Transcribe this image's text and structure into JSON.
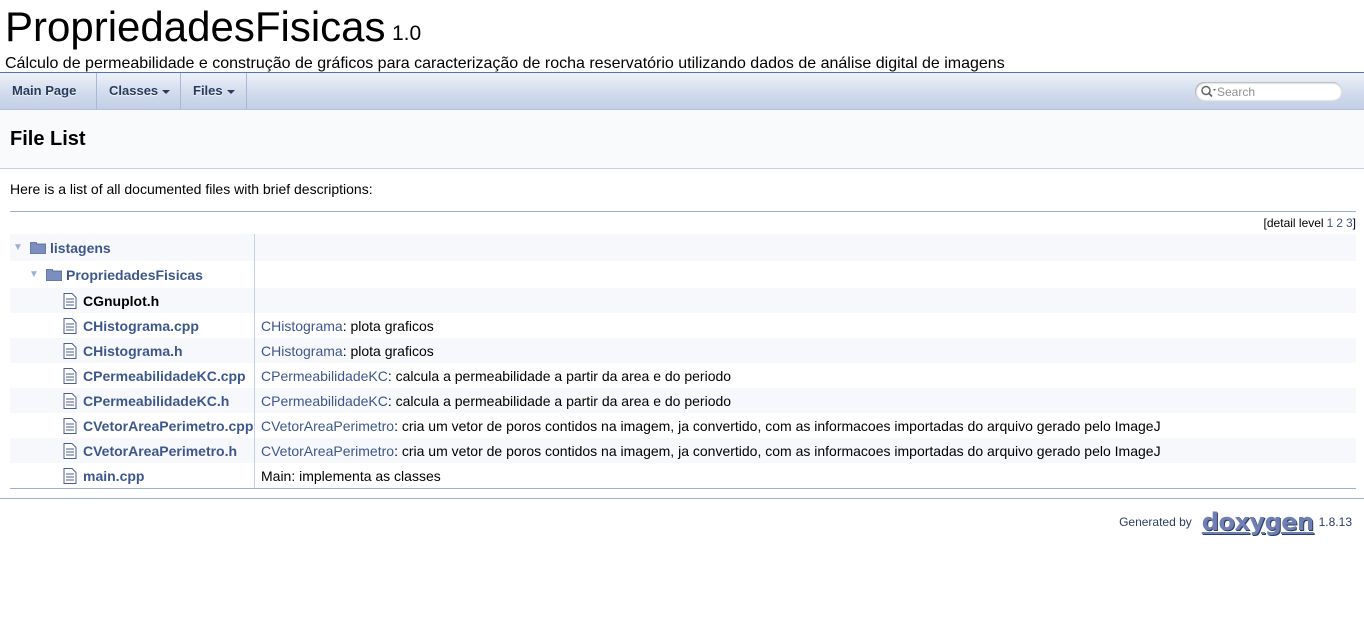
{
  "title_area": {
    "project_name": "PropriedadesFisicas",
    "project_number": "1.0",
    "project_brief": "Cálculo de permeabilidade e construção de gráficos para caracterização de rocha reservatório utilizando dados de análise digital de imagens"
  },
  "navbar": {
    "items": [
      {
        "label": "Main Page"
      },
      {
        "label": "Classes",
        "has_dropdown": true
      },
      {
        "label": "Files",
        "has_dropdown": true
      }
    ],
    "search": {
      "placeholder": "Search",
      "value": ""
    }
  },
  "header": {
    "title": "File List"
  },
  "intro": "Here is a list of all documented files with brief descriptions:",
  "levels": {
    "prefix": "[detail level",
    "values": [
      "1",
      "2",
      "3"
    ],
    "suffix": "]"
  },
  "tree": {
    "dirs": [
      {
        "name": "listagens",
        "icon": "folder-icon",
        "expanded": true
      },
      {
        "name": "PropriedadesFisicas",
        "icon": "folder-icon",
        "expanded": true
      }
    ],
    "files": [
      {
        "name": "CGnuplot.h",
        "linked": false,
        "desc_link": "",
        "desc_text": ""
      },
      {
        "name": "CHistograma.cpp",
        "linked": true,
        "desc_link": "CHistograma",
        "desc_text": ": plota graficos"
      },
      {
        "name": "CHistograma.h",
        "linked": true,
        "desc_link": "CHistograma",
        "desc_text": ": plota graficos"
      },
      {
        "name": "CPermeabilidadeKC.cpp",
        "linked": true,
        "desc_link": "CPermeabilidadeKC",
        "desc_text": ": calcula a permeabilidade a partir da area e do periodo"
      },
      {
        "name": "CPermeabilidadeKC.h",
        "linked": true,
        "desc_link": "CPermeabilidadeKC",
        "desc_text": ": calcula a permeabilidade a partir da area e do periodo"
      },
      {
        "name": "CVetorAreaPerimetro.cpp",
        "linked": true,
        "desc_link": "CVetorAreaPerimetro",
        "desc_text": ": cria um vetor de poros contidos na imagem, ja convertido, com as informacoes importadas do arquivo gerado pelo ImageJ"
      },
      {
        "name": "CVetorAreaPerimetro.h",
        "linked": true,
        "desc_link": "CVetorAreaPerimetro",
        "desc_text": ": cria um vetor de poros contidos na imagem, ja convertido, com as informacoes importadas do arquivo gerado pelo ImageJ"
      },
      {
        "name": "main.cpp",
        "linked": true,
        "desc_link": "",
        "desc_text": "Main: implementa as classes"
      }
    ]
  },
  "footer": {
    "generated_by": "Generated by",
    "logo_text": "doxygen",
    "version": "1.8.13"
  },
  "colors": {
    "link": "#3d578c",
    "nav_text": "#283a5d",
    "border": "#9cafd4"
  }
}
